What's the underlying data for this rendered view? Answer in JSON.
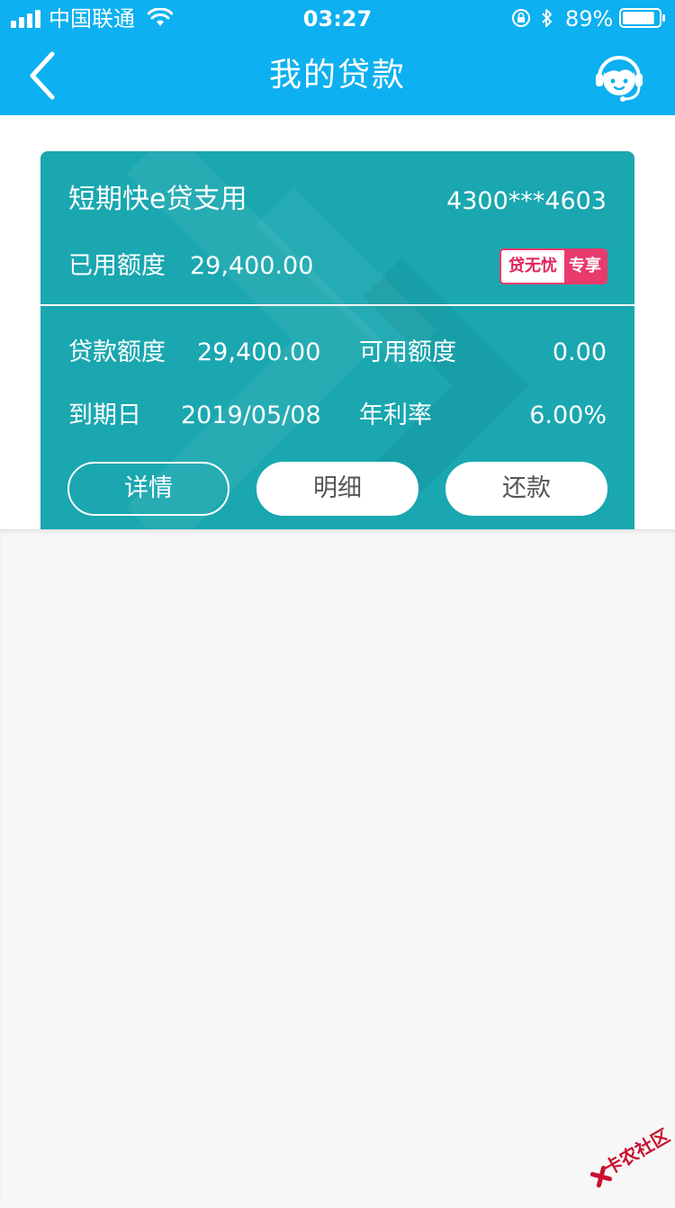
{
  "status_bar": {
    "carrier": "中国联通",
    "time": "03:27",
    "battery_percent": "89%",
    "signal_bars": 4,
    "battery_level": 0.89
  },
  "nav": {
    "title": "我的贷款",
    "back_icon": "chevron-left-icon",
    "service_icon": "customer-service-icon"
  },
  "loan_card": {
    "product_name": "短期快e贷支用",
    "account_no": "4300***4603",
    "used_label": "已用额度",
    "used_value": "29,400.00",
    "promo_badge": {
      "left": "贷无忧",
      "right": "专享"
    },
    "fields": [
      {
        "label": "贷款额度",
        "value": "29,400.00"
      },
      {
        "label": "可用额度",
        "value": "0.00"
      },
      {
        "label": "到期日",
        "value": "2019/05/08"
      },
      {
        "label": "年利率",
        "value": "6.00%"
      }
    ],
    "buttons": {
      "details": "详情",
      "statement": "明细",
      "repay": "还款"
    }
  },
  "watermark": {
    "text": "卡农社区"
  },
  "colors": {
    "header": "#0db0f0",
    "card": "#1aa7b0",
    "badge_accent": "#e83a6b",
    "page_bg": "#f7f7f7"
  }
}
